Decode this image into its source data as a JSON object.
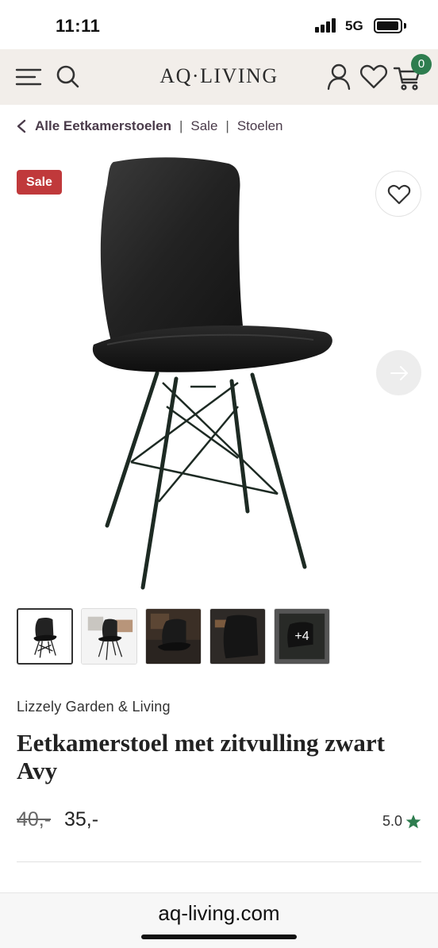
{
  "status_bar": {
    "time": "11:11",
    "network": "5G",
    "icons": [
      "signal-icon",
      "battery-icon"
    ]
  },
  "header": {
    "logo": "AQ·LIVING",
    "cart_count": "0",
    "icons": [
      "menu-icon",
      "search-icon",
      "account-icon",
      "heart-icon",
      "cart-icon"
    ]
  },
  "breadcrumb": {
    "items": [
      "Alle Eetkamerstoelen",
      "Sale",
      "Stoelen"
    ],
    "separator": "|"
  },
  "gallery": {
    "sale_badge": "Sale",
    "thumb_more_label": "+4",
    "thumbnail_count": 5
  },
  "product": {
    "brand": "Lizzely Garden & Living",
    "title": "Eetkamerstoel met zitvulling zwart Avy",
    "old_price": "40,-",
    "price": "35,-",
    "rating": "5.0"
  },
  "browser": {
    "url": "aq-living.com"
  },
  "colors": {
    "header_bg": "#f2eeea",
    "sale_red": "#c0393b",
    "accent_green": "#2e7d4f",
    "breadcrumb_text": "#4a3b4a"
  }
}
